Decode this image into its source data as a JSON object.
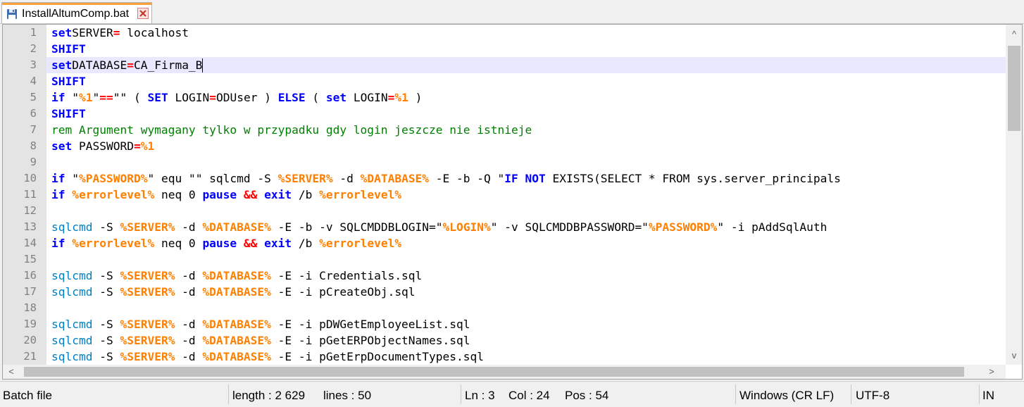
{
  "tab": {
    "filename": "InstallAltumComp.bat",
    "icon": "save-icon",
    "close_icon": "close-icon",
    "accent_color": "#f9a23c"
  },
  "editor": {
    "current_line": 3,
    "current_line_color": "#e8e8ff",
    "colors": {
      "keyword": "#0000ff",
      "operator": "#ff0000",
      "variable": "#ff8000",
      "command": "#0080c0",
      "comment": "#008000"
    },
    "lines": [
      {
        "n": "1",
        "t": [
          [
            "kw",
            "set"
          ],
          [
            "",
            "SERVER"
          ],
          [
            "op",
            "="
          ],
          [
            "",
            " localhost"
          ]
        ]
      },
      {
        "n": "2",
        "t": [
          [
            "kw",
            "SHIFT"
          ]
        ]
      },
      {
        "n": "3",
        "t": [
          [
            "kw",
            "set"
          ],
          [
            "",
            "DATABASE"
          ],
          [
            "op",
            "="
          ],
          [
            "",
            "CA_Firma_B"
          ]
        ]
      },
      {
        "n": "4",
        "t": [
          [
            "kw",
            "SHIFT"
          ]
        ]
      },
      {
        "n": "5",
        "t": [
          [
            "kw",
            "if"
          ],
          [
            "",
            " \""
          ],
          [
            "var",
            "%1"
          ],
          [
            "",
            "\""
          ],
          [
            "op",
            "=="
          ],
          [
            "",
            "\"\" ( "
          ],
          [
            "kw",
            "SET"
          ],
          [
            "",
            " LOGIN"
          ],
          [
            "op",
            "="
          ],
          [
            "",
            "ODUser ) "
          ],
          [
            "kw",
            "ELSE"
          ],
          [
            "",
            " ( "
          ],
          [
            "kw",
            "set"
          ],
          [
            "",
            " LOGIN"
          ],
          [
            "op",
            "="
          ],
          [
            "var",
            "%1"
          ],
          [
            "",
            " )"
          ]
        ]
      },
      {
        "n": "6",
        "t": [
          [
            "kw",
            "SHIFT"
          ]
        ]
      },
      {
        "n": "7",
        "t": [
          [
            "cmt",
            "rem Argument wymagany tylko w przypadku gdy login jeszcze nie istnieje"
          ]
        ]
      },
      {
        "n": "8",
        "t": [
          [
            "kw",
            "set"
          ],
          [
            "",
            " PASSWORD"
          ],
          [
            "op",
            "="
          ],
          [
            "var",
            "%1"
          ]
        ]
      },
      {
        "n": "9",
        "t": []
      },
      {
        "n": "10",
        "t": [
          [
            "kw",
            "if"
          ],
          [
            "",
            " \""
          ],
          [
            "var",
            "%PASSWORD%"
          ],
          [
            "",
            "\" equ \"\" sqlcmd -S "
          ],
          [
            "var",
            "%SERVER%"
          ],
          [
            "",
            " -d "
          ],
          [
            "var",
            "%DATABASE%"
          ],
          [
            "",
            " -E -b -Q \""
          ],
          [
            "kw",
            "IF NOT"
          ],
          [
            "",
            " EXISTS(SELECT * FROM sys.server_principals"
          ]
        ]
      },
      {
        "n": "11",
        "t": [
          [
            "kw",
            "if"
          ],
          [
            "",
            " "
          ],
          [
            "var",
            "%errorlevel%"
          ],
          [
            "",
            " neq 0 "
          ],
          [
            "kw",
            "pause"
          ],
          [
            "",
            " "
          ],
          [
            "op",
            "&&"
          ],
          [
            "",
            " "
          ],
          [
            "kw",
            "exit"
          ],
          [
            "",
            " /b "
          ],
          [
            "var",
            "%errorlevel%"
          ]
        ]
      },
      {
        "n": "12",
        "t": []
      },
      {
        "n": "13",
        "t": [
          [
            "cmd",
            "sqlcmd"
          ],
          [
            "",
            " -S "
          ],
          [
            "var",
            "%SERVER%"
          ],
          [
            "",
            " -d "
          ],
          [
            "var",
            "%DATABASE%"
          ],
          [
            "",
            " -E -b -v SQLCMDDBLOGIN=\""
          ],
          [
            "var",
            "%LOGIN%"
          ],
          [
            "",
            "\" -v SQLCMDDBPASSWORD=\""
          ],
          [
            "var",
            "%PASSWORD%"
          ],
          [
            "",
            "\" -i pAddSqlAuth"
          ]
        ]
      },
      {
        "n": "14",
        "t": [
          [
            "kw",
            "if"
          ],
          [
            "",
            " "
          ],
          [
            "var",
            "%errorlevel%"
          ],
          [
            "",
            " neq 0 "
          ],
          [
            "kw",
            "pause"
          ],
          [
            "",
            " "
          ],
          [
            "op",
            "&&"
          ],
          [
            "",
            " "
          ],
          [
            "kw",
            "exit"
          ],
          [
            "",
            " /b "
          ],
          [
            "var",
            "%errorlevel%"
          ]
        ]
      },
      {
        "n": "15",
        "t": []
      },
      {
        "n": "16",
        "t": [
          [
            "cmd",
            "sqlcmd"
          ],
          [
            "",
            " -S "
          ],
          [
            "var",
            "%SERVER%"
          ],
          [
            "",
            " -d "
          ],
          [
            "var",
            "%DATABASE%"
          ],
          [
            "",
            " -E -i Credentials.sql"
          ]
        ]
      },
      {
        "n": "17",
        "t": [
          [
            "cmd",
            "sqlcmd"
          ],
          [
            "",
            " -S "
          ],
          [
            "var",
            "%SERVER%"
          ],
          [
            "",
            " -d "
          ],
          [
            "var",
            "%DATABASE%"
          ],
          [
            "",
            " -E -i pCreateObj.sql"
          ]
        ]
      },
      {
        "n": "18",
        "t": []
      },
      {
        "n": "19",
        "t": [
          [
            "cmd",
            "sqlcmd"
          ],
          [
            "",
            " -S "
          ],
          [
            "var",
            "%SERVER%"
          ],
          [
            "",
            " -d "
          ],
          [
            "var",
            "%DATABASE%"
          ],
          [
            "",
            " -E -i pDWGetEmployeeList.sql"
          ]
        ]
      },
      {
        "n": "20",
        "t": [
          [
            "cmd",
            "sqlcmd"
          ],
          [
            "",
            " -S "
          ],
          [
            "var",
            "%SERVER%"
          ],
          [
            "",
            " -d "
          ],
          [
            "var",
            "%DATABASE%"
          ],
          [
            "",
            " -E -i pGetERPObjectNames.sql"
          ]
        ]
      },
      {
        "n": "21",
        "t": [
          [
            "cmd",
            "sqlcmd"
          ],
          [
            "",
            " -S "
          ],
          [
            "var",
            "%SERVER%"
          ],
          [
            "",
            " -d "
          ],
          [
            "var",
            "%DATABASE%"
          ],
          [
            "",
            " -E -i pGetErpDocumentTypes.sql"
          ]
        ]
      }
    ]
  },
  "scrollbars": {
    "left_arrow": "<",
    "right_arrow": ">",
    "up_arrow": "^",
    "down_arrow": "v"
  },
  "statusbar": {
    "file_type": "Batch file",
    "length": "length : 2 629",
    "lines": "lines : 50",
    "ln": "Ln : 3",
    "col": "Col : 24",
    "pos": "Pos : 54",
    "eol": "Windows (CR LF)",
    "encoding": "UTF-8",
    "mode": "IN"
  }
}
